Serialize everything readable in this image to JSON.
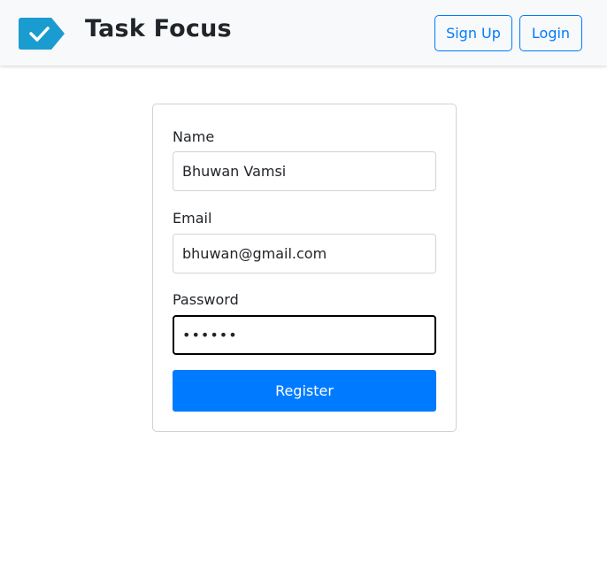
{
  "app": {
    "title": "Task Focus",
    "logo_icon": "check-tag-icon",
    "accent_color": "#007bff",
    "logo_color": "#1a9cd0"
  },
  "nav": {
    "signup_label": "Sign Up",
    "login_label": "Login"
  },
  "form": {
    "name_label": "Name",
    "name_value": "Bhuwan Vamsi",
    "email_label": "Email",
    "email_value": "bhuwan@gmail.com",
    "password_label": "Password",
    "password_value": "••••••",
    "register_label": "Register"
  }
}
